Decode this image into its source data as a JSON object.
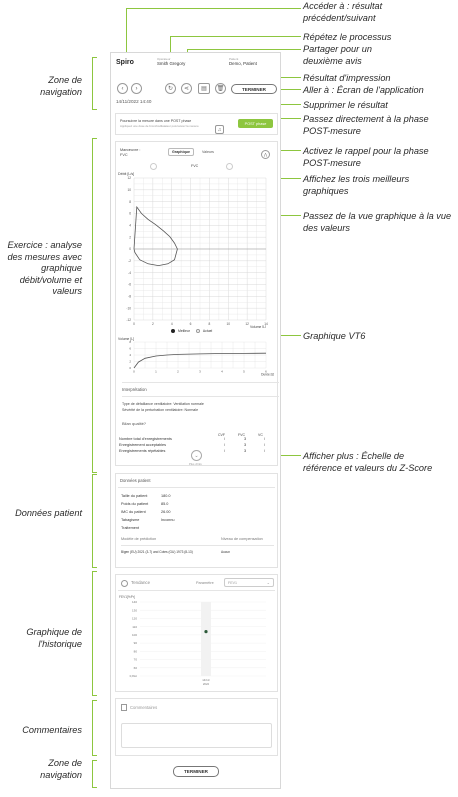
{
  "callouts_right": [
    "Accéder à : résultat précédent/suivant",
    "Répétez le processus",
    "Partager pour un deuxième avis",
    "Résultat d'impression",
    "Aller à : Écran de l'application",
    "Supprimer le résultat",
    "Passez directement à la phase POST-mesure",
    "Activez le rappel pour la phase POST-mesure",
    "Affichez les trois meilleurs graphiques",
    "Passez de la vue graphique à la vue des valeurs",
    "Graphique VT6",
    "Afficher plus : Échelle de référence et valeurs du Z-Score"
  ],
  "callouts_left": [
    "Zone de navigation",
    "Exercice : analyse des mesures avec graphique débit/volume et valeurs",
    "Données patient",
    "Graphique de l'historique",
    "Commentaires",
    "Zone de navigation"
  ],
  "app": {
    "logo": "Spiro",
    "operator_label": "Opérateur",
    "operator": "Smith Gregory",
    "patient_label": "Patient",
    "patient": "Demo, Patient",
    "finish_button": "TERMINER",
    "datetime": "14/11/2022 14:40"
  },
  "post_banner": {
    "text": "Poursuivre la mesure dans une POST phase",
    "subtext": "Appliquez une dose de bronchodilatateur puis lancez la mesure",
    "button": "POST phase"
  },
  "exercise": {
    "maneuver_label": "Manœuvre :",
    "maneuver": "FVC",
    "tab_graph": "Graphique",
    "tab_values": "Valeurs",
    "fvc_label": "FVC",
    "legend_best": "Meilleur",
    "legend_actual": "Actuel"
  },
  "chart_data": [
    {
      "type": "line",
      "title": "",
      "ylabel": "Débit [L/s]",
      "xlabel": "Volume [L]",
      "xlim": [
        0,
        14
      ],
      "ylim": [
        -12,
        12
      ],
      "x_ticks": [
        "0",
        "2",
        "4",
        "6",
        "8",
        "10",
        "12",
        "14"
      ],
      "y_ticks": [
        "12",
        "10",
        "8",
        "6",
        "4",
        "2",
        "0",
        "-2",
        "-4",
        "-6",
        "-8",
        "-10",
        "-12"
      ],
      "grid": true,
      "series": [
        {
          "name": "Meilleur",
          "x": [
            0,
            0.3,
            0.8,
            1.5,
            2.3,
            3.1,
            3.8,
            4.3,
            4.6,
            4.3,
            3.6,
            2.6,
            1.5,
            0.6,
            0.1,
            0
          ],
          "y": [
            0,
            7.1,
            6.0,
            5.0,
            4.1,
            3.1,
            2.1,
            1.0,
            0,
            -1.8,
            -2.5,
            -2.8,
            -2.5,
            -1.8,
            -0.6,
            0
          ]
        }
      ]
    },
    {
      "type": "line",
      "title": "",
      "ylabel": "Volume [L]",
      "xlabel": "Durée [s]",
      "xlim": [
        0,
        6
      ],
      "ylim": [
        0,
        8
      ],
      "x_ticks": [
        "0",
        "1",
        "2",
        "3",
        "4",
        "5",
        "6"
      ],
      "y_ticks": [
        "8",
        "6",
        "4",
        "2",
        "0"
      ],
      "grid": true,
      "series": [
        {
          "name": "VT6",
          "x": [
            0,
            0.2,
            0.5,
            1,
            1.5,
            2,
            3,
            4,
            5,
            6
          ],
          "y": [
            0,
            1.8,
            3.0,
            3.7,
            4.0,
            4.2,
            4.35,
            4.45,
            4.5,
            4.55
          ]
        }
      ]
    }
  ],
  "interpretation": {
    "title": "Interprétation",
    "line1": "Type de défaillance ventilatoire: Ventilation normale",
    "line2": "Sévérité de la perturbation ventilatoire: Normale"
  },
  "quality": {
    "title": "Bilan qualité?",
    "headers": [
      "CVF",
      "FVC",
      "VC"
    ],
    "rows": [
      {
        "label": "Nombre total d'enregistrements",
        "values": [
          "/",
          "3",
          "/"
        ]
      },
      {
        "label": "Enregistrement acceptables",
        "values": [
          "/",
          "3",
          "/"
        ]
      },
      {
        "label": "Enregistrements répétables",
        "values": [
          "/",
          "3",
          "/"
        ]
      }
    ],
    "more_label": "Plus d'info"
  },
  "patient_data": {
    "title": "Données patient",
    "rows": [
      {
        "label": "Taille du patient",
        "value": "180.0"
      },
      {
        "label": "Poids du patient",
        "value": "85.0"
      },
      {
        "label": "IMC du patient",
        "value": "26.00"
      },
      {
        "label": "Tabagisme",
        "value": "Inconnu"
      },
      {
        "label": "Traitement",
        "value": ""
      }
    ],
    "prediction_label": "Modèle de prédiction",
    "compensation_label": "Niveau de compensation",
    "prediction_value": "Bigen (EU) 2021 (3-7) and Cotes (GU) 1973 (8-13)",
    "compensation_value": "Aucun"
  },
  "trend": {
    "title": "Tendance",
    "param_label": "Paramètre",
    "param_value": "FEV1",
    "y_label": "FEV1[%Pr]",
    "y_ticks": [
      "140",
      "130",
      "120",
      "110",
      "100",
      "90",
      "80",
      "70",
      "60",
      "0,8Lit"
    ],
    "point_value": 104,
    "x_label": "14/11/\n2022"
  },
  "comments": {
    "title": "Commentaires"
  },
  "bottom_nav": {
    "finish_button": "TERMINER"
  }
}
